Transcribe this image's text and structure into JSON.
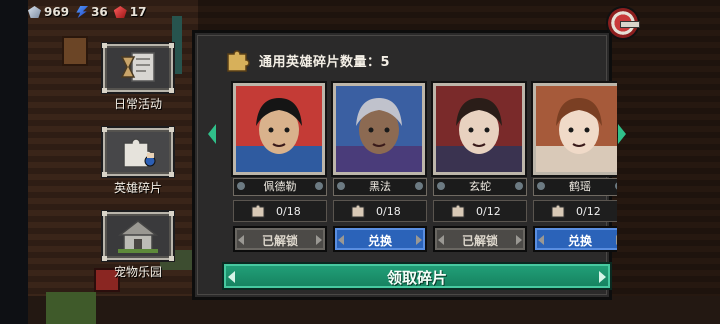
{
  "resources": [
    {
      "icon": "diamond-gem-icon",
      "value": "969"
    },
    {
      "icon": "blue-energy-icon",
      "value": "36"
    },
    {
      "icon": "red-ruby-icon",
      "value": "17"
    }
  ],
  "menu": [
    {
      "key": "daily",
      "label": "日常活动",
      "icon": "hourglass-scroll-icon"
    },
    {
      "key": "fragments",
      "label": "英雄碎片",
      "icon": "puzzle-piece-icon"
    },
    {
      "key": "pet",
      "label": "宠物乐园",
      "icon": "pet-house-icon"
    }
  ],
  "panel": {
    "header_text": "通用英雄碎片数量：5",
    "claim_label": "领取碎片"
  },
  "heroes": [
    {
      "name": "佩德勒",
      "progress": "0/18",
      "action": "已解锁",
      "state": "unlocked",
      "palette": {
        "bg": "#c43b36",
        "skin": "#d9b28c",
        "hair": "#151515",
        "shirt": "#2f5ba0"
      }
    },
    {
      "name": "黑法",
      "progress": "0/18",
      "action": "兑换",
      "state": "exchange",
      "palette": {
        "bg": "#3a5fa2",
        "skin": "#8c6a52",
        "hair": "#c0c2cc",
        "shirt": "#4a3c7a"
      }
    },
    {
      "name": "玄蛇",
      "progress": "0/12",
      "action": "已解锁",
      "state": "unlocked",
      "palette": {
        "bg": "#7a2a2a",
        "skin": "#e8d2c0",
        "hair": "#2a1d18",
        "shirt": "#3a3350"
      }
    },
    {
      "name": "鹤瑶",
      "progress": "0/12",
      "action": "兑换",
      "state": "exchange",
      "palette": {
        "bg": "#a65a3a",
        "skin": "#f0dac8",
        "hair": "#7a3f23",
        "shirt": "#d9c9b8"
      }
    }
  ]
}
